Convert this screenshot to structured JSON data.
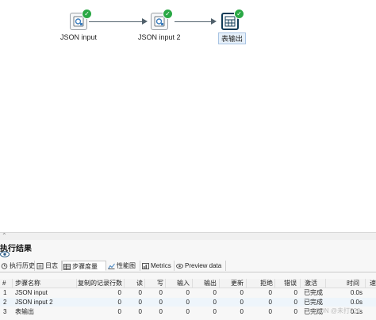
{
  "canvas": {
    "steps": [
      {
        "label": "JSON input",
        "icon": "json-input-icon",
        "status": "check-icon"
      },
      {
        "label": "JSON input 2",
        "icon": "json-input-icon",
        "status": "check-icon"
      },
      {
        "label": "表输出",
        "icon": "table-output-icon",
        "status": "check-icon"
      }
    ],
    "status_color": "#2aa845"
  },
  "results": {
    "title": "执行结果",
    "tabs": [
      {
        "label": "执行历史",
        "icon": "history-icon"
      },
      {
        "label": "日志",
        "icon": "log-icon"
      },
      {
        "label": "步骤度量",
        "icon": "metrics-grid-icon",
        "active": true
      },
      {
        "label": "性能图",
        "icon": "perf-chart-icon"
      },
      {
        "label": "Metrics",
        "icon": "metrics-icon"
      },
      {
        "label": "Preview data",
        "icon": "eye-icon"
      }
    ],
    "table": {
      "headers": [
        "#",
        "步骤名称",
        "复制的记录行数",
        "读",
        "写",
        "输入",
        "输出",
        "更新",
        "拒绝",
        "错误",
        "激活",
        "时间",
        "速"
      ],
      "rows": [
        [
          "1",
          "JSON input",
          "0",
          "0",
          "0",
          "0",
          "0",
          "0",
          "0",
          "0",
          "已完成",
          "0.0s"
        ],
        [
          "2",
          "JSON input 2",
          "0",
          "0",
          "0",
          "0",
          "0",
          "0",
          "0",
          "0",
          "已完成",
          "0.0s"
        ],
        [
          "3",
          "表输出",
          "0",
          "0",
          "0",
          "0",
          "0",
          "0",
          "0",
          "0",
          "已完成",
          "0.1s"
        ]
      ]
    }
  },
  "watermark": "CSDN @未打220"
}
